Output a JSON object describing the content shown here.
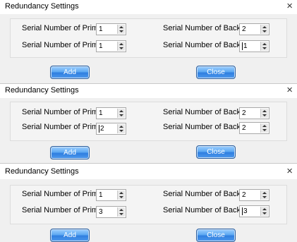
{
  "dialogs": [
    {
      "title": "Redundancy Settings",
      "close_glyph": "×",
      "primary_label_1": "Serial Number of Primar...",
      "primary_label_2": "Serial Number of Primar...",
      "backup_label_1": "Serial Number of Backu...",
      "backup_label_2": "Serial Number of Backu...",
      "primary_value_1": "1",
      "primary_value_2": "1",
      "backup_value_1": "2",
      "backup_value_2": "1",
      "add_label": "Add",
      "close_label": "Close"
    },
    {
      "title": "Redundancy Settings",
      "close_glyph": "×",
      "primary_label_1": "Serial Number of Primar...",
      "primary_label_2": "Serial Number of Primar...",
      "backup_label_1": "Serial Number of Backu...",
      "backup_label_2": "Serial Number of Backu...",
      "primary_value_1": "1",
      "primary_value_2": "2",
      "backup_value_1": "2",
      "backup_value_2": "2",
      "add_label": "Add",
      "close_label": "Close"
    },
    {
      "title": "Redundancy Settings",
      "close_glyph": "×",
      "primary_label_1": "Serial Number of Primar...",
      "primary_label_2": "Serial Number of Primar...",
      "backup_label_1": "Serial Number of Backu...",
      "backup_label_2": "Serial Number of Backu...",
      "primary_value_1": "1",
      "primary_value_2": "3",
      "backup_value_1": "2",
      "backup_value_2": "3",
      "add_label": "Add",
      "close_label": "Close"
    }
  ],
  "colors": {
    "button_blue": "#2f7fe0",
    "panel_gray": "#f0f0f0"
  },
  "icons": {
    "close": "close-icon",
    "spin_up": "chevron-up-icon",
    "spin_down": "chevron-down-icon"
  }
}
